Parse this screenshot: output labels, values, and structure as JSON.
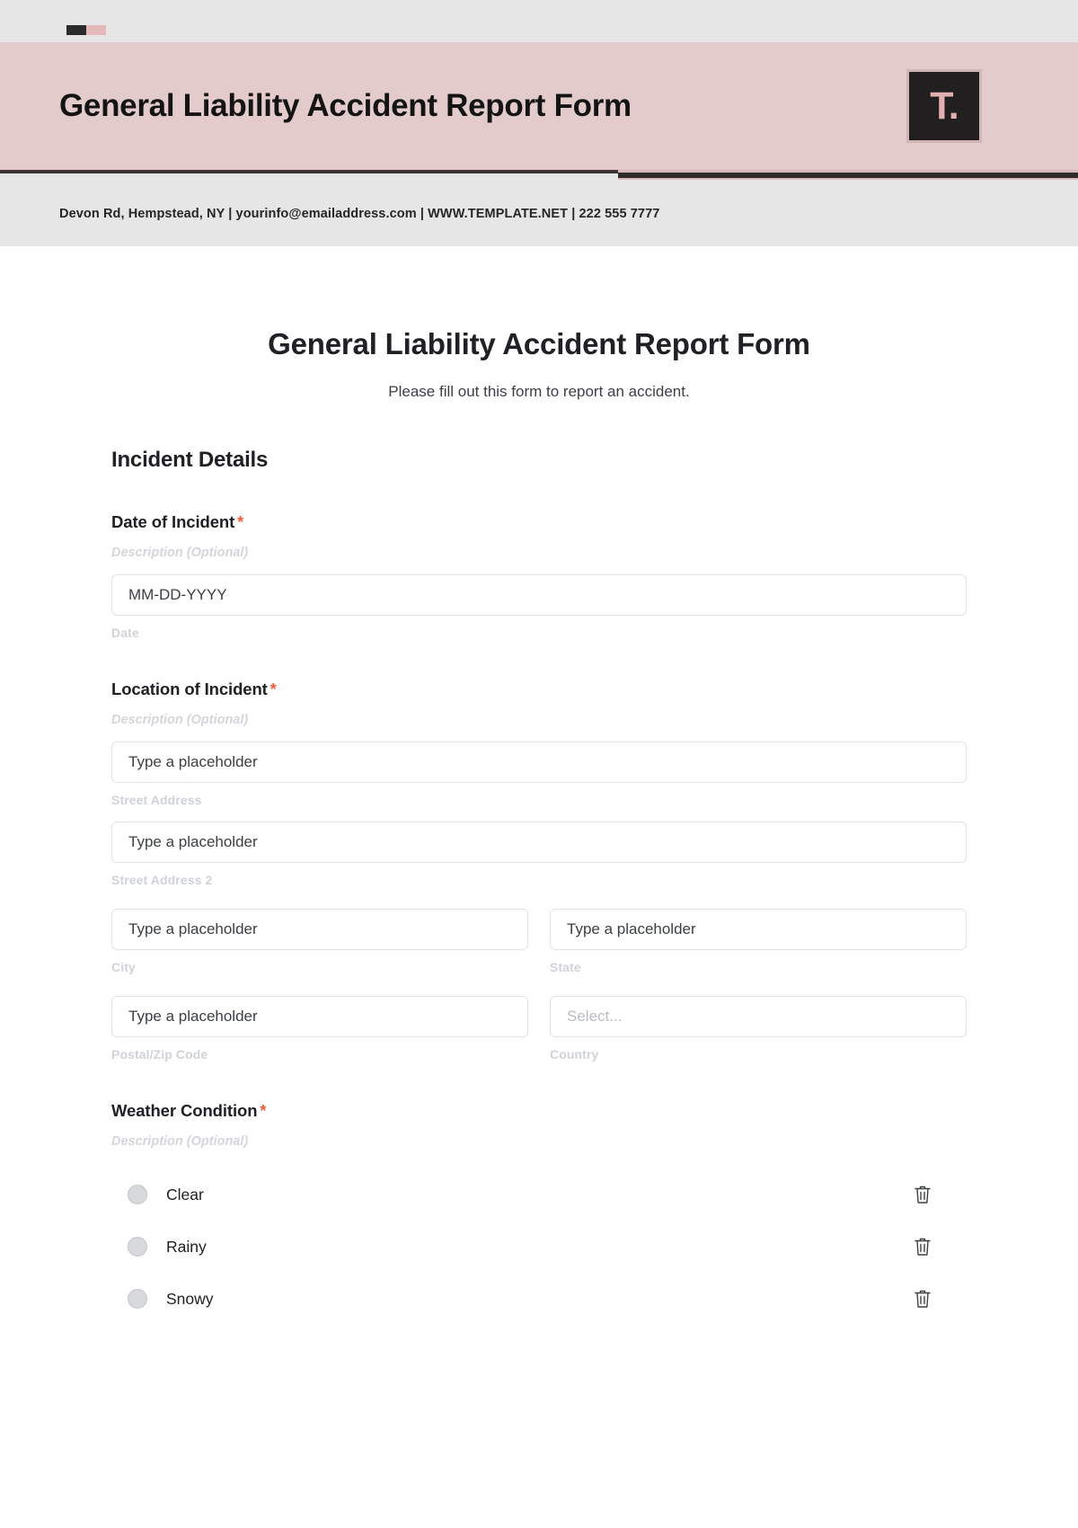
{
  "letterhead": {
    "title": "General Liability Accident Report Form",
    "logo_glyph": "T.",
    "contact_line": "Devon Rd, Hempstead, NY | yourinfo@emailaddress.com | WWW.TEMPLATE.NET | 222 555 7777",
    "colors": {
      "band": "#e3cbcb",
      "surround": "#e6e6e6",
      "logo_bg": "#211f1f",
      "logo_fg": "#e3b0b2",
      "rule_dark": "#2e2a2b"
    }
  },
  "form": {
    "heading": "General Liability Accident Report Form",
    "subheading": "Please fill out this form to report an accident.",
    "required_marker": "*",
    "section_title": "Incident Details",
    "description_placeholder": "Description (Optional)",
    "fields": {
      "date_of_incident": {
        "label": "Date of Incident",
        "description": "Description (Optional)",
        "input_value": "MM-DD-YYYY",
        "sub_label": "Date"
      },
      "location_of_incident": {
        "label": "Location of Incident",
        "description": "Description (Optional)",
        "street_address": {
          "input_value": "Type a placeholder",
          "sub_label": "Street Address"
        },
        "street_address_2": {
          "input_value": "Type a placeholder",
          "sub_label": "Street Address 2"
        },
        "city": {
          "input_value": "Type a placeholder",
          "sub_label": "City"
        },
        "state": {
          "input_value": "Type a placeholder",
          "sub_label": "State"
        },
        "postal_zip": {
          "input_value": "Type a placeholder",
          "sub_label": "Postal/Zip Code"
        },
        "country": {
          "input_value": "Select...",
          "sub_label": "Country"
        }
      },
      "weather_condition": {
        "label": "Weather Condition",
        "description": "Description (Optional)",
        "options": [
          {
            "label": "Clear",
            "delete_icon": "trash-icon"
          },
          {
            "label": "Rainy",
            "delete_icon": "trash-icon"
          },
          {
            "label": "Snowy",
            "delete_icon": "trash-icon"
          }
        ]
      }
    }
  }
}
